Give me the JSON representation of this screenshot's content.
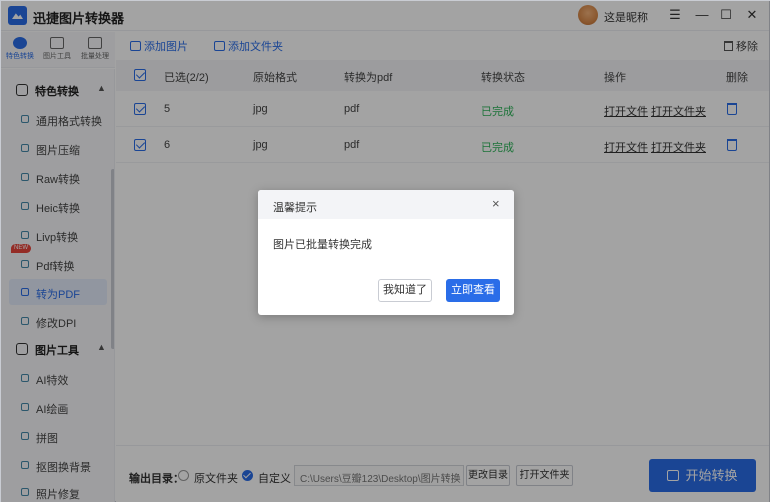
{
  "app": {
    "title": "迅捷图片转换器",
    "user_name": "这是昵称",
    "window_controls": {
      "menu": "☰",
      "minimize": "—",
      "maximize": "☐",
      "close": "✕"
    }
  },
  "nav_tabs": [
    {
      "label": "特色转换",
      "icon": "special-convert-icon",
      "active": true
    },
    {
      "label": "图片工具",
      "icon": "image-tools-icon",
      "active": false
    },
    {
      "label": "批量处理",
      "icon": "batch-icon",
      "active": false
    }
  ],
  "sidebar": {
    "section1": {
      "title": "特色转换",
      "chevron": "▲"
    },
    "items1": [
      {
        "label": "通用格式转换"
      },
      {
        "label": "图片压缩"
      },
      {
        "label": "Raw转换"
      },
      {
        "label": "Heic转换"
      },
      {
        "label": "Livp转换"
      },
      {
        "label": "Pdf转换",
        "badge": "NEW"
      },
      {
        "label": "转为PDF",
        "active": true
      },
      {
        "label": "修改DPI"
      }
    ],
    "section2": {
      "title": "图片工具",
      "chevron": "▲"
    },
    "items2": [
      {
        "label": "AI特效"
      },
      {
        "label": "AI绘画"
      },
      {
        "label": "拼图"
      },
      {
        "label": "抠图换背景"
      },
      {
        "label": "照片修复"
      }
    ]
  },
  "toolbar": {
    "add_image": "添加图片",
    "add_folder": "添加文件夹",
    "remove": "移除"
  },
  "table": {
    "headers": {
      "selected": "已选(2/2)",
      "original_format": "原始格式",
      "convert_to": "转换为pdf",
      "status": "转换状态",
      "operation": "操作",
      "delete": "删除"
    },
    "rows": [
      {
        "name": "5",
        "format": "jpg",
        "target": "pdf",
        "status": "已完成",
        "open_file": "打开文件",
        "open_folder": "打开文件夹"
      },
      {
        "name": "6",
        "format": "jpg",
        "target": "pdf",
        "status": "已完成",
        "open_file": "打开文件",
        "open_folder": "打开文件夹"
      }
    ]
  },
  "dialog": {
    "title": "温馨提示",
    "close": "×",
    "message": "图片已批量转换完成",
    "secondary_button": "我知道了",
    "primary_button": "立即查看"
  },
  "bottom": {
    "output_label": "输出目录：",
    "radio_original": "原文件夹",
    "radio_custom": "自定义",
    "path": "C:\\Users\\豆瓣123\\Desktop\\图片转换",
    "change_dir": "更改目录",
    "open_folder": "打开文件夹",
    "start": "开始转换"
  },
  "colors": {
    "accent": "#2a6de8",
    "success": "#2eb55a",
    "badge": "#e8453c"
  }
}
